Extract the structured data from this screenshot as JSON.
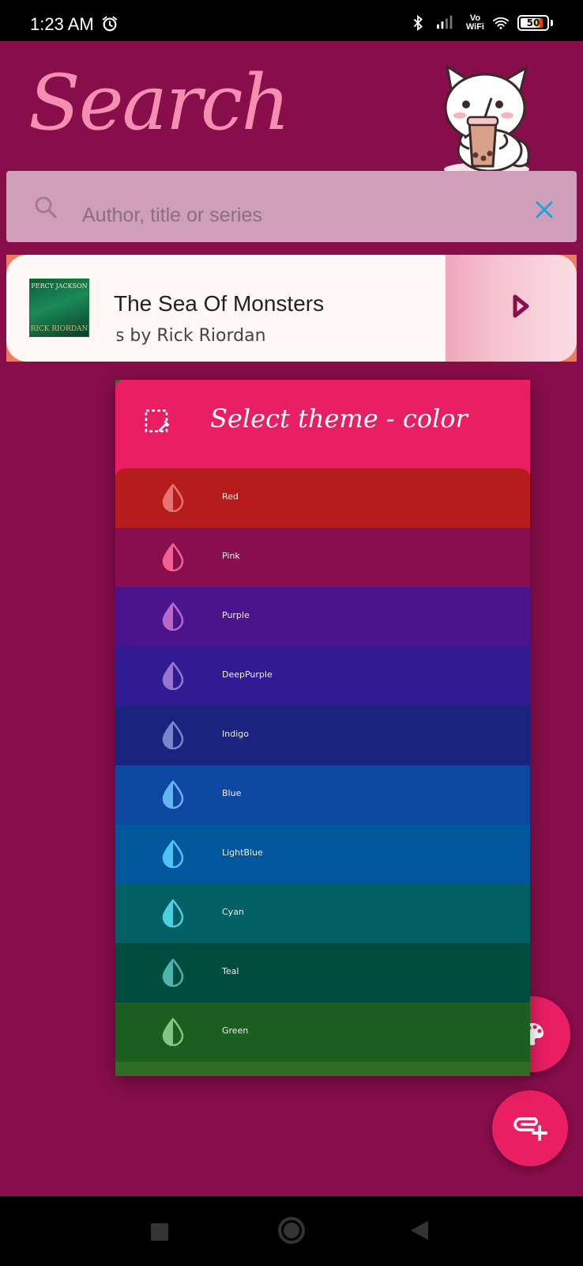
{
  "status_bar": {
    "time": "1:23 AM",
    "vo": "Vo",
    "wifi_label": "WiFi",
    "battery": "50",
    "icons": [
      "alarm-icon",
      "bluetooth-icon",
      "signal-icon",
      "wifi-icon",
      "battery-icon"
    ]
  },
  "header": {
    "title": "Search",
    "mascot": "cat-drinking-boba-sticker"
  },
  "search": {
    "placeholder": "Author, title or series",
    "value": ""
  },
  "book": {
    "title": "The Sea Of Monsters",
    "author": "ns by Rick Riordan",
    "cover_top": "PERCY JACKSON",
    "cover_bottom": "RICK RIORDAN"
  },
  "theme_dialog": {
    "title": "Select theme - color",
    "colors": [
      {
        "label": "Red",
        "bg": "#b71c1c",
        "icon": "#e57373"
      },
      {
        "label": "Pink",
        "bg": "#880e4f",
        "icon": "#f06292"
      },
      {
        "label": "Purple",
        "bg": "#4a148c",
        "icon": "#ba68c8"
      },
      {
        "label": "DeepPurple",
        "bg": "#311b92",
        "icon": "#9575cd"
      },
      {
        "label": "Indigo",
        "bg": "#1a237e",
        "icon": "#7986cb"
      },
      {
        "label": "Blue",
        "bg": "#0d47a1",
        "icon": "#64b5f6"
      },
      {
        "label": "LightBlue",
        "bg": "#01579b",
        "icon": "#4fc3f7"
      },
      {
        "label": "Cyan",
        "bg": "#006064",
        "icon": "#4dd0e1"
      },
      {
        "label": "Teal",
        "bg": "#004d40",
        "icon": "#4db6ac"
      },
      {
        "label": "Green",
        "bg": "#1b5e20",
        "icon": "#81c784"
      }
    ]
  },
  "colors": {
    "app_bg": "#870d4b",
    "accent": "#e91e63",
    "title": "#f48fb1"
  }
}
